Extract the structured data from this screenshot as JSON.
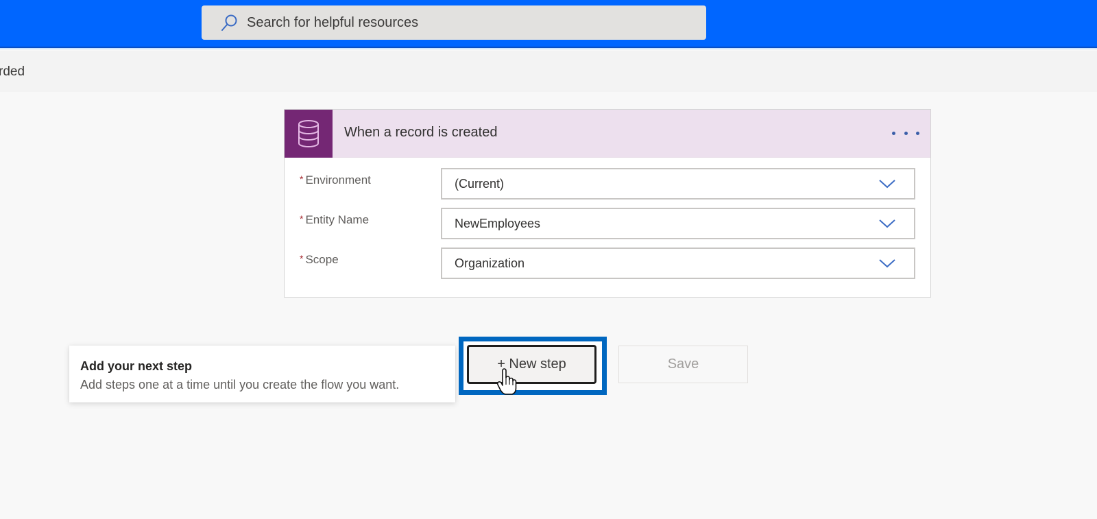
{
  "topbar": {
    "search_placeholder": "Search for helpful resources",
    "search_icon": "search-icon",
    "brand_color": "#0066ff"
  },
  "toolbar": {
    "status_text": "rded"
  },
  "trigger_card": {
    "icon": "database-icon",
    "title": "When a record is created",
    "more_icon": "ellipsis-icon",
    "accent_color": "#742774",
    "fields": [
      {
        "label": "Environment",
        "required": true,
        "value": "(Current)"
      },
      {
        "label": "Entity Name",
        "required": true,
        "value": "NewEmployees"
      },
      {
        "label": "Scope",
        "required": true,
        "value": "Organization"
      }
    ]
  },
  "hint": {
    "title": "Add your next step",
    "description": "Add steps one at a time until you create the flow you want."
  },
  "actions": {
    "new_step_label": "+ New step",
    "save_label": "Save",
    "highlight_color": "#0067c0"
  }
}
